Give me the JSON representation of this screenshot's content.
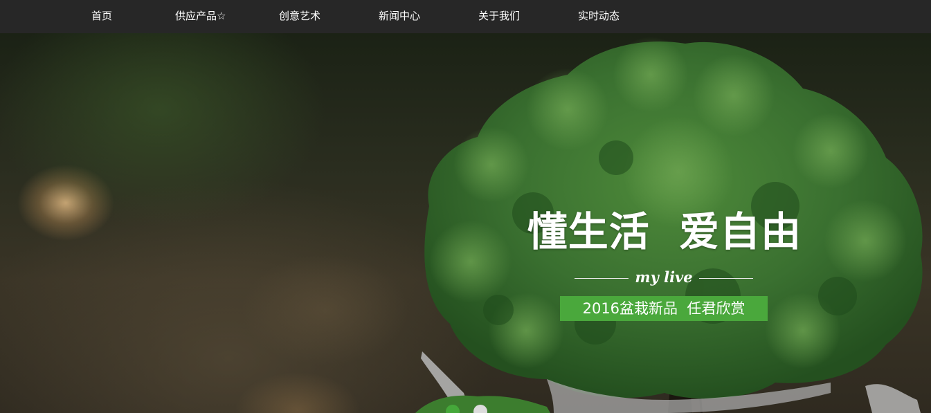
{
  "nav": {
    "items": [
      {
        "label": "首页"
      },
      {
        "label": "供应产品☆"
      },
      {
        "label": "创意艺术"
      },
      {
        "label": "新闻中心"
      },
      {
        "label": "关于我们"
      },
      {
        "label": "实时动态"
      }
    ]
  },
  "hero": {
    "title": "懂生活  爱自由",
    "subtitle": "my live",
    "tag": "2016盆栽新品  任君欣赏",
    "slider": {
      "current_slide": 1,
      "total_slides": 2
    }
  },
  "colors": {
    "nav_bg": "#272727",
    "accent_green": "#4aa83c",
    "text": "#ffffff"
  }
}
